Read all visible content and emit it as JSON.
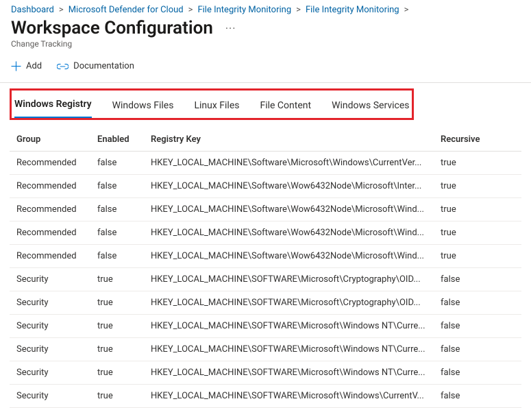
{
  "breadcrumb": {
    "items": [
      {
        "label": "Dashboard"
      },
      {
        "label": "Microsoft Defender for Cloud"
      },
      {
        "label": "File Integrity Monitoring"
      },
      {
        "label": "File Integrity Monitoring"
      }
    ]
  },
  "header": {
    "title": "Workspace Configuration",
    "more": "···",
    "subtitle": "Change Tracking"
  },
  "toolbar": {
    "add_label": "Add",
    "doc_label": "Documentation"
  },
  "tabs": [
    {
      "label": "Windows Registry",
      "active": true
    },
    {
      "label": "Windows Files",
      "active": false
    },
    {
      "label": "Linux Files",
      "active": false
    },
    {
      "label": "File Content",
      "active": false
    },
    {
      "label": "Windows Services",
      "active": false
    }
  ],
  "table": {
    "columns": [
      "Group",
      "Enabled",
      "Registry Key",
      "Recursive"
    ],
    "rows": [
      {
        "group": "Recommended",
        "enabled": "false",
        "key": "HKEY_LOCAL_MACHINE\\Software\\Microsoft\\Windows\\CurrentVer...",
        "recursive": "true"
      },
      {
        "group": "Recommended",
        "enabled": "false",
        "key": "HKEY_LOCAL_MACHINE\\Software\\Wow6432Node\\Microsoft\\Inter...",
        "recursive": "true"
      },
      {
        "group": "Recommended",
        "enabled": "false",
        "key": "HKEY_LOCAL_MACHINE\\Software\\Wow6432Node\\Microsoft\\Wind...",
        "recursive": "true"
      },
      {
        "group": "Recommended",
        "enabled": "false",
        "key": "HKEY_LOCAL_MACHINE\\Software\\Wow6432Node\\Microsoft\\Wind...",
        "recursive": "true"
      },
      {
        "group": "Recommended",
        "enabled": "false",
        "key": "HKEY_LOCAL_MACHINE\\Software\\Wow6432Node\\Microsoft\\Wind...",
        "recursive": "true"
      },
      {
        "group": "Security",
        "enabled": "true",
        "key": "HKEY_LOCAL_MACHINE\\SOFTWARE\\Microsoft\\Cryptography\\OID...",
        "recursive": "false"
      },
      {
        "group": "Security",
        "enabled": "true",
        "key": "HKEY_LOCAL_MACHINE\\SOFTWARE\\Microsoft\\Cryptography\\OID...",
        "recursive": "false"
      },
      {
        "group": "Security",
        "enabled": "true",
        "key": "HKEY_LOCAL_MACHINE\\SOFTWARE\\Microsoft\\Windows NT\\Curre...",
        "recursive": "false"
      },
      {
        "group": "Security",
        "enabled": "true",
        "key": "HKEY_LOCAL_MACHINE\\SOFTWARE\\Microsoft\\Windows NT\\Curre...",
        "recursive": "false"
      },
      {
        "group": "Security",
        "enabled": "true",
        "key": "HKEY_LOCAL_MACHINE\\SOFTWARE\\Microsoft\\Windows NT\\Curre...",
        "recursive": "false"
      },
      {
        "group": "Security",
        "enabled": "true",
        "key": "HKEY_LOCAL_MACHINE\\SOFTWARE\\Microsoft\\Windows\\CurrentV...",
        "recursive": "false"
      }
    ]
  }
}
